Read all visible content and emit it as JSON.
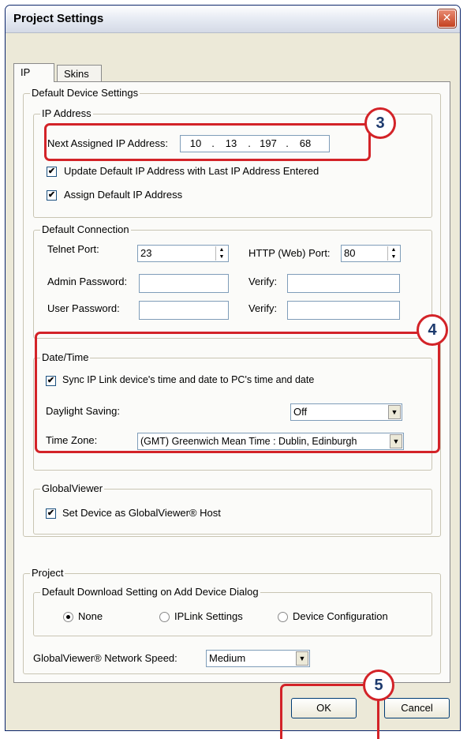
{
  "window": {
    "title": "Project Settings",
    "close_glyph": "✕"
  },
  "tabs": [
    {
      "label": "IP",
      "active": true
    },
    {
      "label": "Skins",
      "active": false
    }
  ],
  "default_device_settings": {
    "label": "Default Device Settings",
    "ip_address": {
      "label": "IP Address",
      "next_assigned_label": "Next Assigned IP Address:",
      "octets": [
        "10",
        ".",
        "13",
        ".",
        "197",
        ".",
        "68"
      ],
      "update_default_label": "Update Default IP Address with Last IP Address Entered",
      "update_default_checked": true,
      "assign_default_label": "Assign Default IP Address",
      "assign_default_checked": true
    },
    "default_connection": {
      "label": "Default Connection",
      "telnet_port_label": "Telnet Port:",
      "telnet_port_value": "23",
      "http_port_label": "HTTP (Web) Port:",
      "http_port_value": "80",
      "admin_password_label": "Admin Password:",
      "user_password_label": "User Password:",
      "verify_label": "Verify:"
    },
    "date_time": {
      "label": "Date/Time",
      "sync_label": "Sync IP Link device's time and date to PC's time and date",
      "sync_checked": true,
      "daylight_saving_label": "Daylight Saving:",
      "daylight_saving_value": "Off",
      "time_zone_label": "Time Zone:",
      "time_zone_value": "(GMT) Greenwich Mean Time : Dublin, Edinburgh"
    },
    "globalviewer": {
      "label": "GlobalViewer",
      "set_host_label": "Set Device as GlobalViewer® Host",
      "set_host_checked": true
    }
  },
  "project": {
    "label": "Project",
    "download_group_label": "Default Download Setting on Add Device Dialog",
    "radios": [
      {
        "label": "None",
        "selected": true
      },
      {
        "label": "IPLink Settings",
        "selected": false
      },
      {
        "label": "Device Configuration",
        "selected": false
      }
    ],
    "network_speed_label": "GlobalViewer® Network Speed:",
    "network_speed_value": "Medium"
  },
  "buttons": {
    "ok": "OK",
    "cancel": "Cancel"
  },
  "callouts": [
    "3",
    "4",
    "5"
  ],
  "glyphs": {
    "check": "✔",
    "dropdown_arrow": "▼",
    "spin_up": "▲",
    "spin_down": "▼"
  },
  "colors": {
    "highlight": "#d32328",
    "badge_text": "#1d3a6e",
    "title_text": "#000000"
  }
}
